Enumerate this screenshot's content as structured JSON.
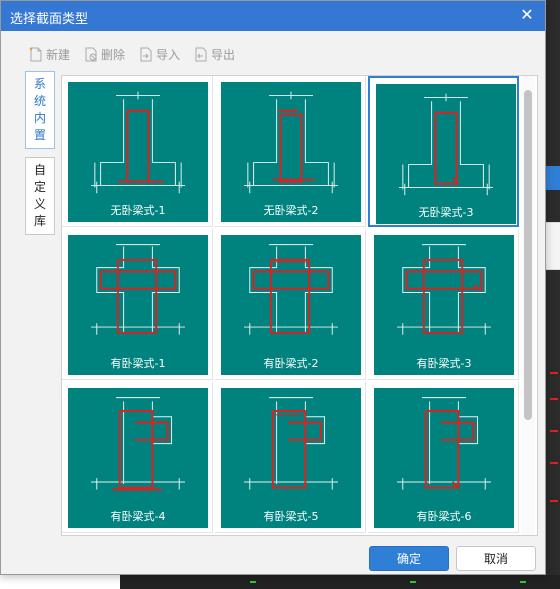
{
  "dialog": {
    "title": "选择截面类型",
    "close_glyph": "✕"
  },
  "toolbar": [
    {
      "label": "新建",
      "icon": "new-doc-icon"
    },
    {
      "label": "删除",
      "icon": "delete-doc-icon"
    },
    {
      "label": "导入",
      "icon": "import-icon"
    },
    {
      "label": "导出",
      "icon": "export-icon"
    }
  ],
  "side_tabs": [
    {
      "label": "系统内置",
      "active": true
    },
    {
      "label": "自定义库",
      "active": false
    }
  ],
  "sections": [
    {
      "label": "无卧梁式-1",
      "kind": "plain",
      "variant": 1,
      "selected": false
    },
    {
      "label": "无卧梁式-2",
      "kind": "plain",
      "variant": 2,
      "selected": false
    },
    {
      "label": "无卧梁式-3",
      "kind": "plain",
      "variant": 3,
      "selected": true
    },
    {
      "label": "有卧梁式-1",
      "kind": "cross",
      "variant": 1,
      "selected": false
    },
    {
      "label": "有卧梁式-2",
      "kind": "cross",
      "variant": 2,
      "selected": false
    },
    {
      "label": "有卧梁式-3",
      "kind": "cross",
      "variant": 3,
      "selected": false
    },
    {
      "label": "有卧梁式-4",
      "kind": "half",
      "variant": 1,
      "selected": false
    },
    {
      "label": "有卧梁式-5",
      "kind": "half",
      "variant": 2,
      "selected": false
    },
    {
      "label": "有卧梁式-6",
      "kind": "half",
      "variant": 3,
      "selected": false
    }
  ],
  "buttons": {
    "ok": "确定",
    "cancel": "取消"
  },
  "colors": {
    "accent": "#3478d4",
    "thumbnail_bg": "#00827e",
    "rebar": "#e02020"
  }
}
